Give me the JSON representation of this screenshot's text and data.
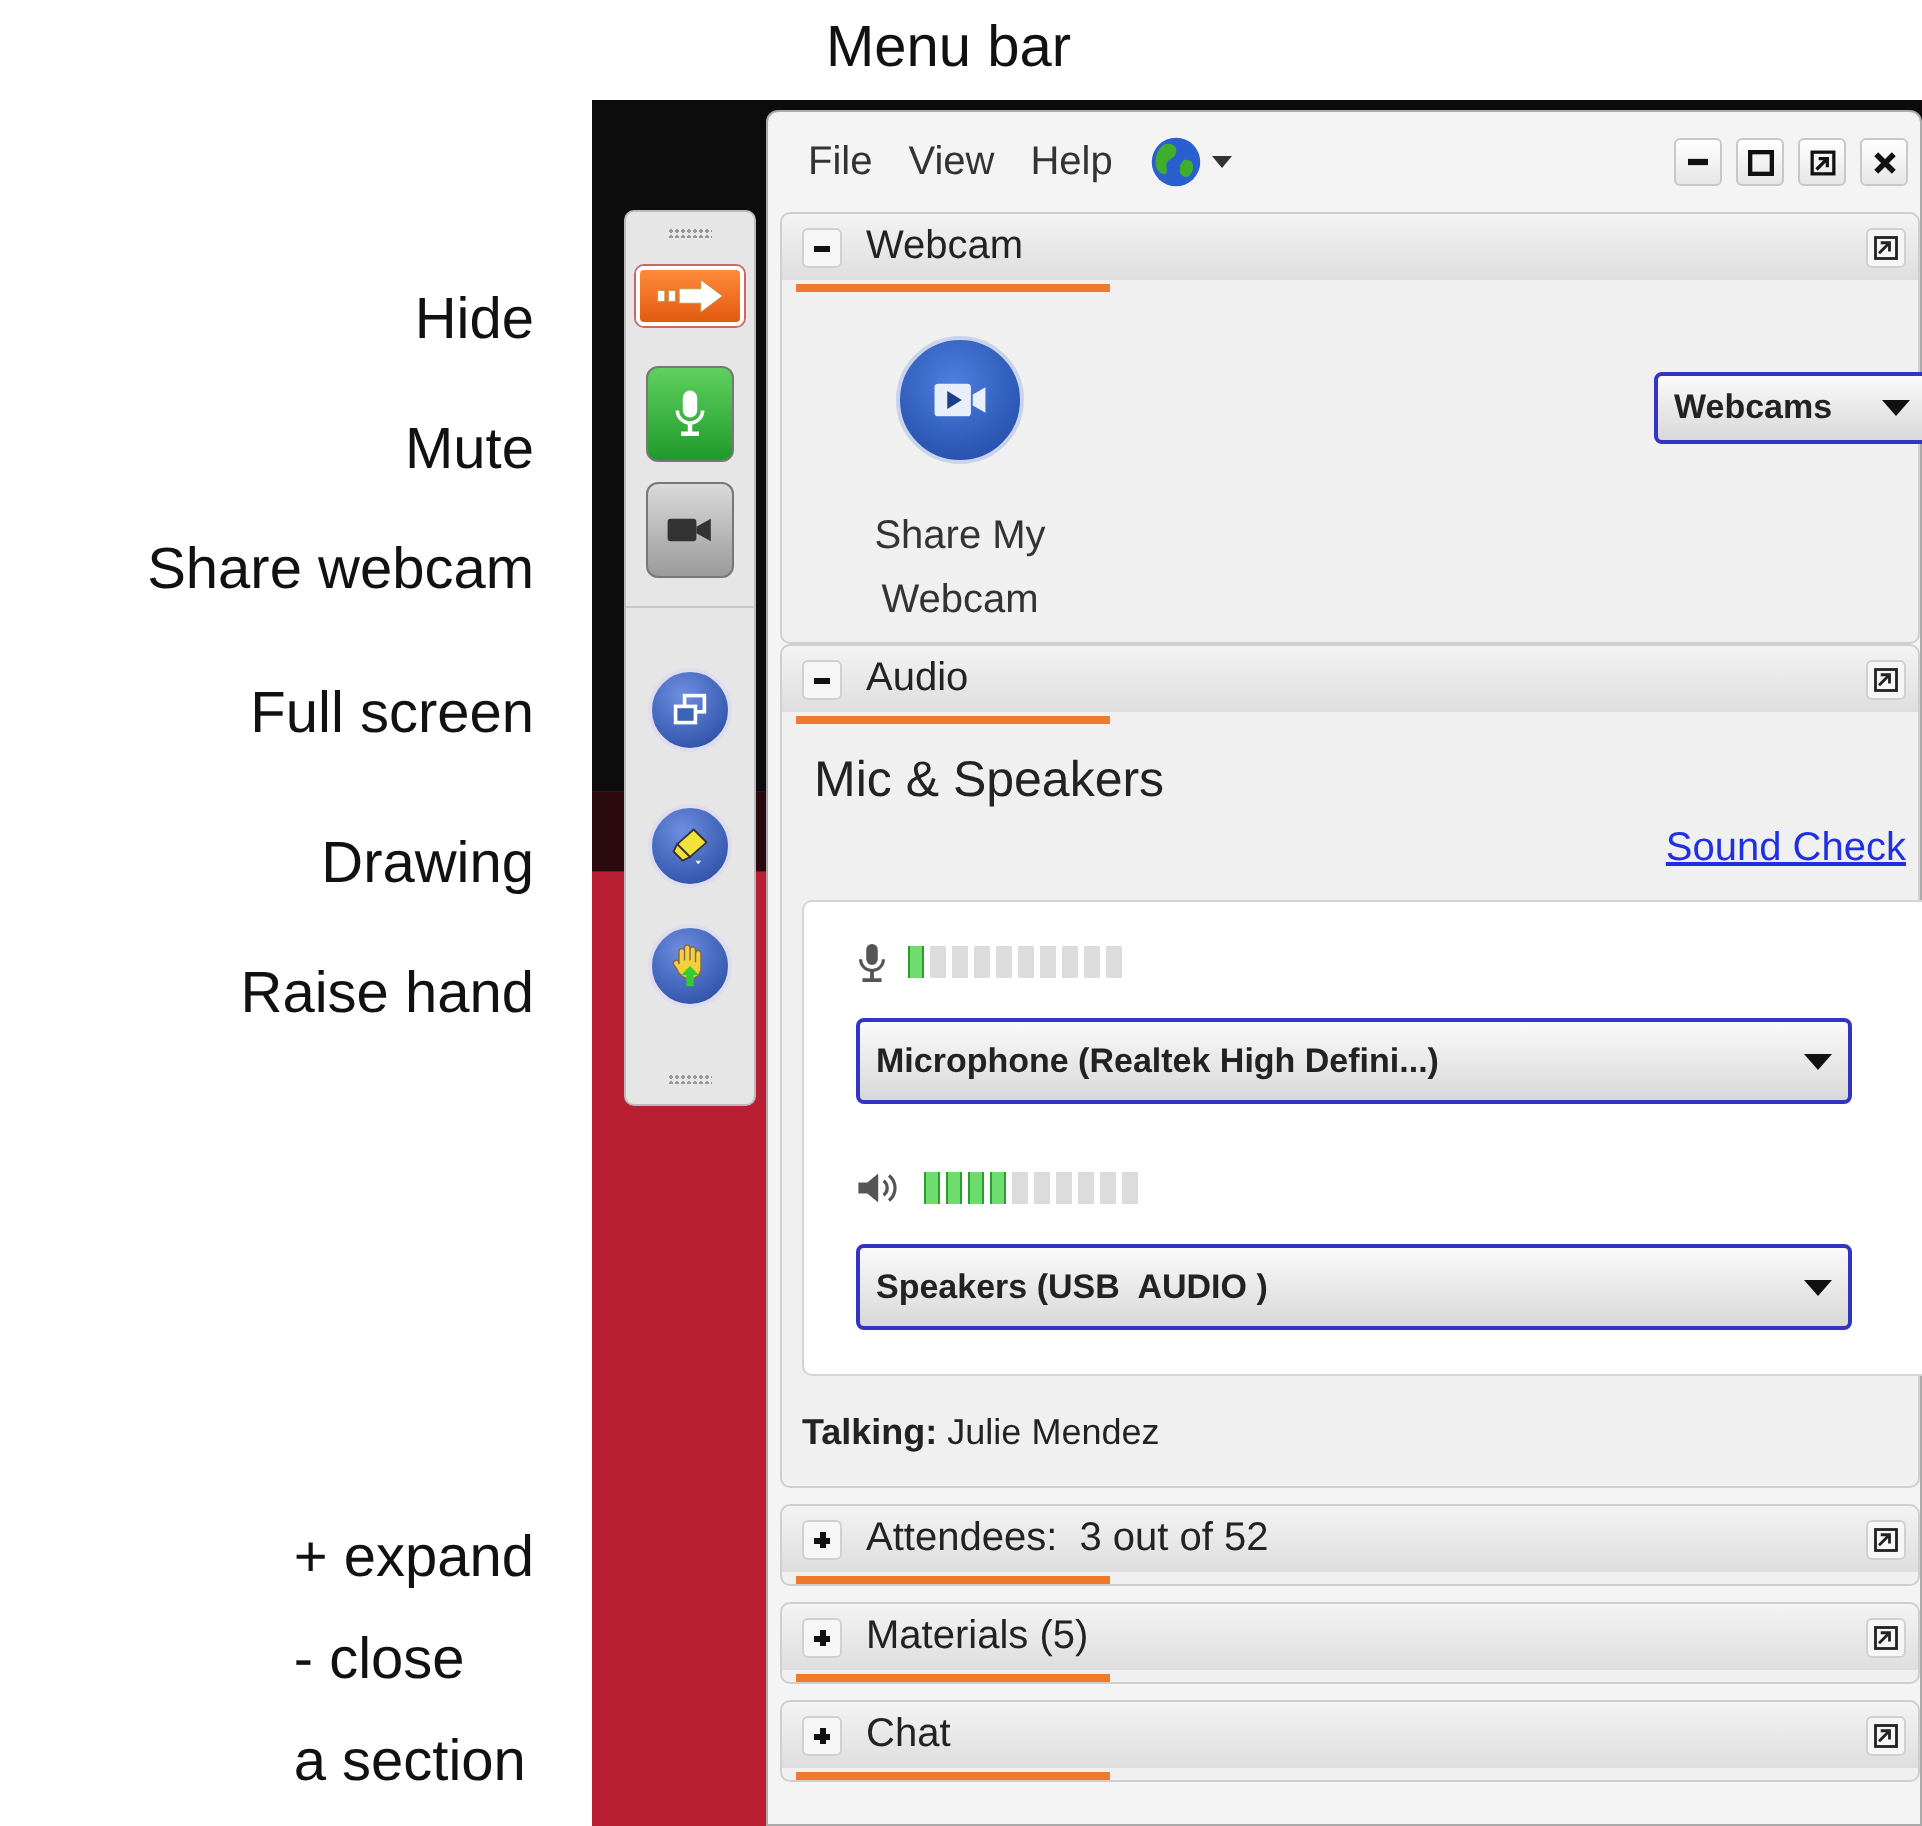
{
  "annotations": {
    "title": "Menu bar",
    "toolbar_labels": [
      "Hide",
      "Mute",
      "Share webcam",
      "Full screen",
      "Drawing",
      "Raise hand"
    ],
    "section_note": [
      "+ expand",
      "- close",
      "a section"
    ]
  },
  "toolbar": [
    {
      "kind": "hide"
    },
    {
      "kind": "mic",
      "on": true
    },
    {
      "kind": "webcam",
      "on": false
    },
    {
      "kind": "fullscreen"
    },
    {
      "kind": "drawing"
    },
    {
      "kind": "raise_hand"
    }
  ],
  "window": {
    "menu": [
      "File",
      "View",
      "Help"
    ]
  },
  "sections": [
    {
      "kind": "webcam",
      "title": "Webcam",
      "expanded": true,
      "share_label": "Share My Webcam",
      "dropdown": "Webcams"
    },
    {
      "kind": "audio",
      "title": "Audio",
      "expanded": true,
      "heading": "Mic & Speakers",
      "link": "Sound Check",
      "devices": [
        {
          "kind": "mic",
          "level": 0.1,
          "device": "Microphone (Realtek High Defini...)"
        },
        {
          "kind": "speaker",
          "level": 0.4,
          "device": "Speakers (USB  AUDIO )"
        }
      ],
      "talking": "**Talking:** Julie Mendez"
    },
    {
      "title": "Attendees:  3 out of 52",
      "expanded": false
    },
    {
      "title": "Materials (5)",
      "expanded": false
    },
    {
      "title": "Chat",
      "expanded": false
    }
  ]
}
